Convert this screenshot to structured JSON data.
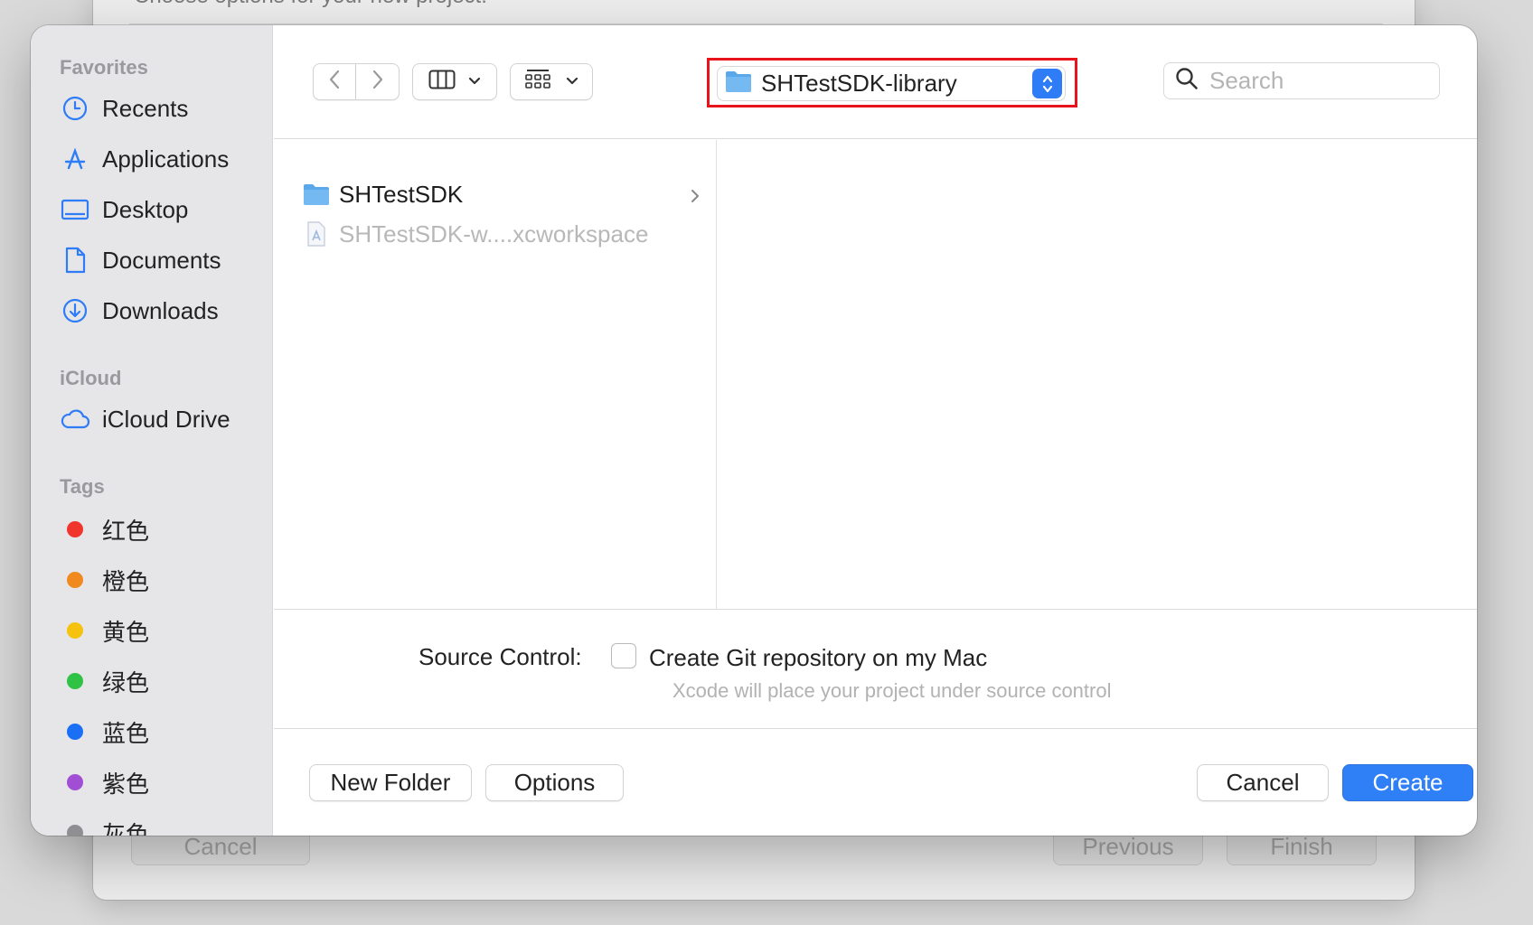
{
  "background_window": {
    "subtitle": "Choose options for your new project:",
    "cancel_label": "Cancel",
    "previous_label": "Previous",
    "finish_label": "Finish"
  },
  "sidebar": {
    "favorites_heading": "Favorites",
    "favorites": [
      {
        "label": "Recents",
        "icon": "clock-icon"
      },
      {
        "label": "Applications",
        "icon": "applications-icon"
      },
      {
        "label": "Desktop",
        "icon": "desktop-icon"
      },
      {
        "label": "Documents",
        "icon": "document-icon"
      },
      {
        "label": "Downloads",
        "icon": "download-icon"
      }
    ],
    "icloud_heading": "iCloud",
    "icloud": [
      {
        "label": "iCloud Drive",
        "icon": "cloud-icon"
      }
    ],
    "tags_heading": "Tags",
    "tags": [
      {
        "label": "红色",
        "color": "#f0352c"
      },
      {
        "label": "橙色",
        "color": "#f08a1e"
      },
      {
        "label": "黄色",
        "color": "#f5c210"
      },
      {
        "label": "绿色",
        "color": "#2fc245"
      },
      {
        "label": "蓝色",
        "color": "#1a6ff5"
      },
      {
        "label": "紫色",
        "color": "#a04fd4"
      },
      {
        "label": "灰色",
        "color": "#8e8e93"
      }
    ]
  },
  "toolbar": {
    "back_icon": "chevron-left-icon",
    "forward_icon": "chevron-right-icon",
    "view_mode_icon": "columns-view-icon",
    "group_icon": "grid-icon",
    "path_label": "SHTestSDK-library",
    "search_placeholder": "Search"
  },
  "browser": {
    "items": [
      {
        "label": "SHTestSDK",
        "type": "folder",
        "enabled": true
      },
      {
        "label": "SHTestSDK-w....xcworkspace",
        "type": "workspace",
        "enabled": false
      }
    ]
  },
  "source_control": {
    "label": "Source Control:",
    "checkbox_label": "Create Git repository on my Mac",
    "hint": "Xcode will place your project under source control",
    "checked": false
  },
  "footer": {
    "new_folder_label": "New Folder",
    "options_label": "Options",
    "cancel_label": "Cancel",
    "create_label": "Create"
  },
  "colors": {
    "accent": "#2f80f7",
    "highlight_box": "#e8141c"
  }
}
